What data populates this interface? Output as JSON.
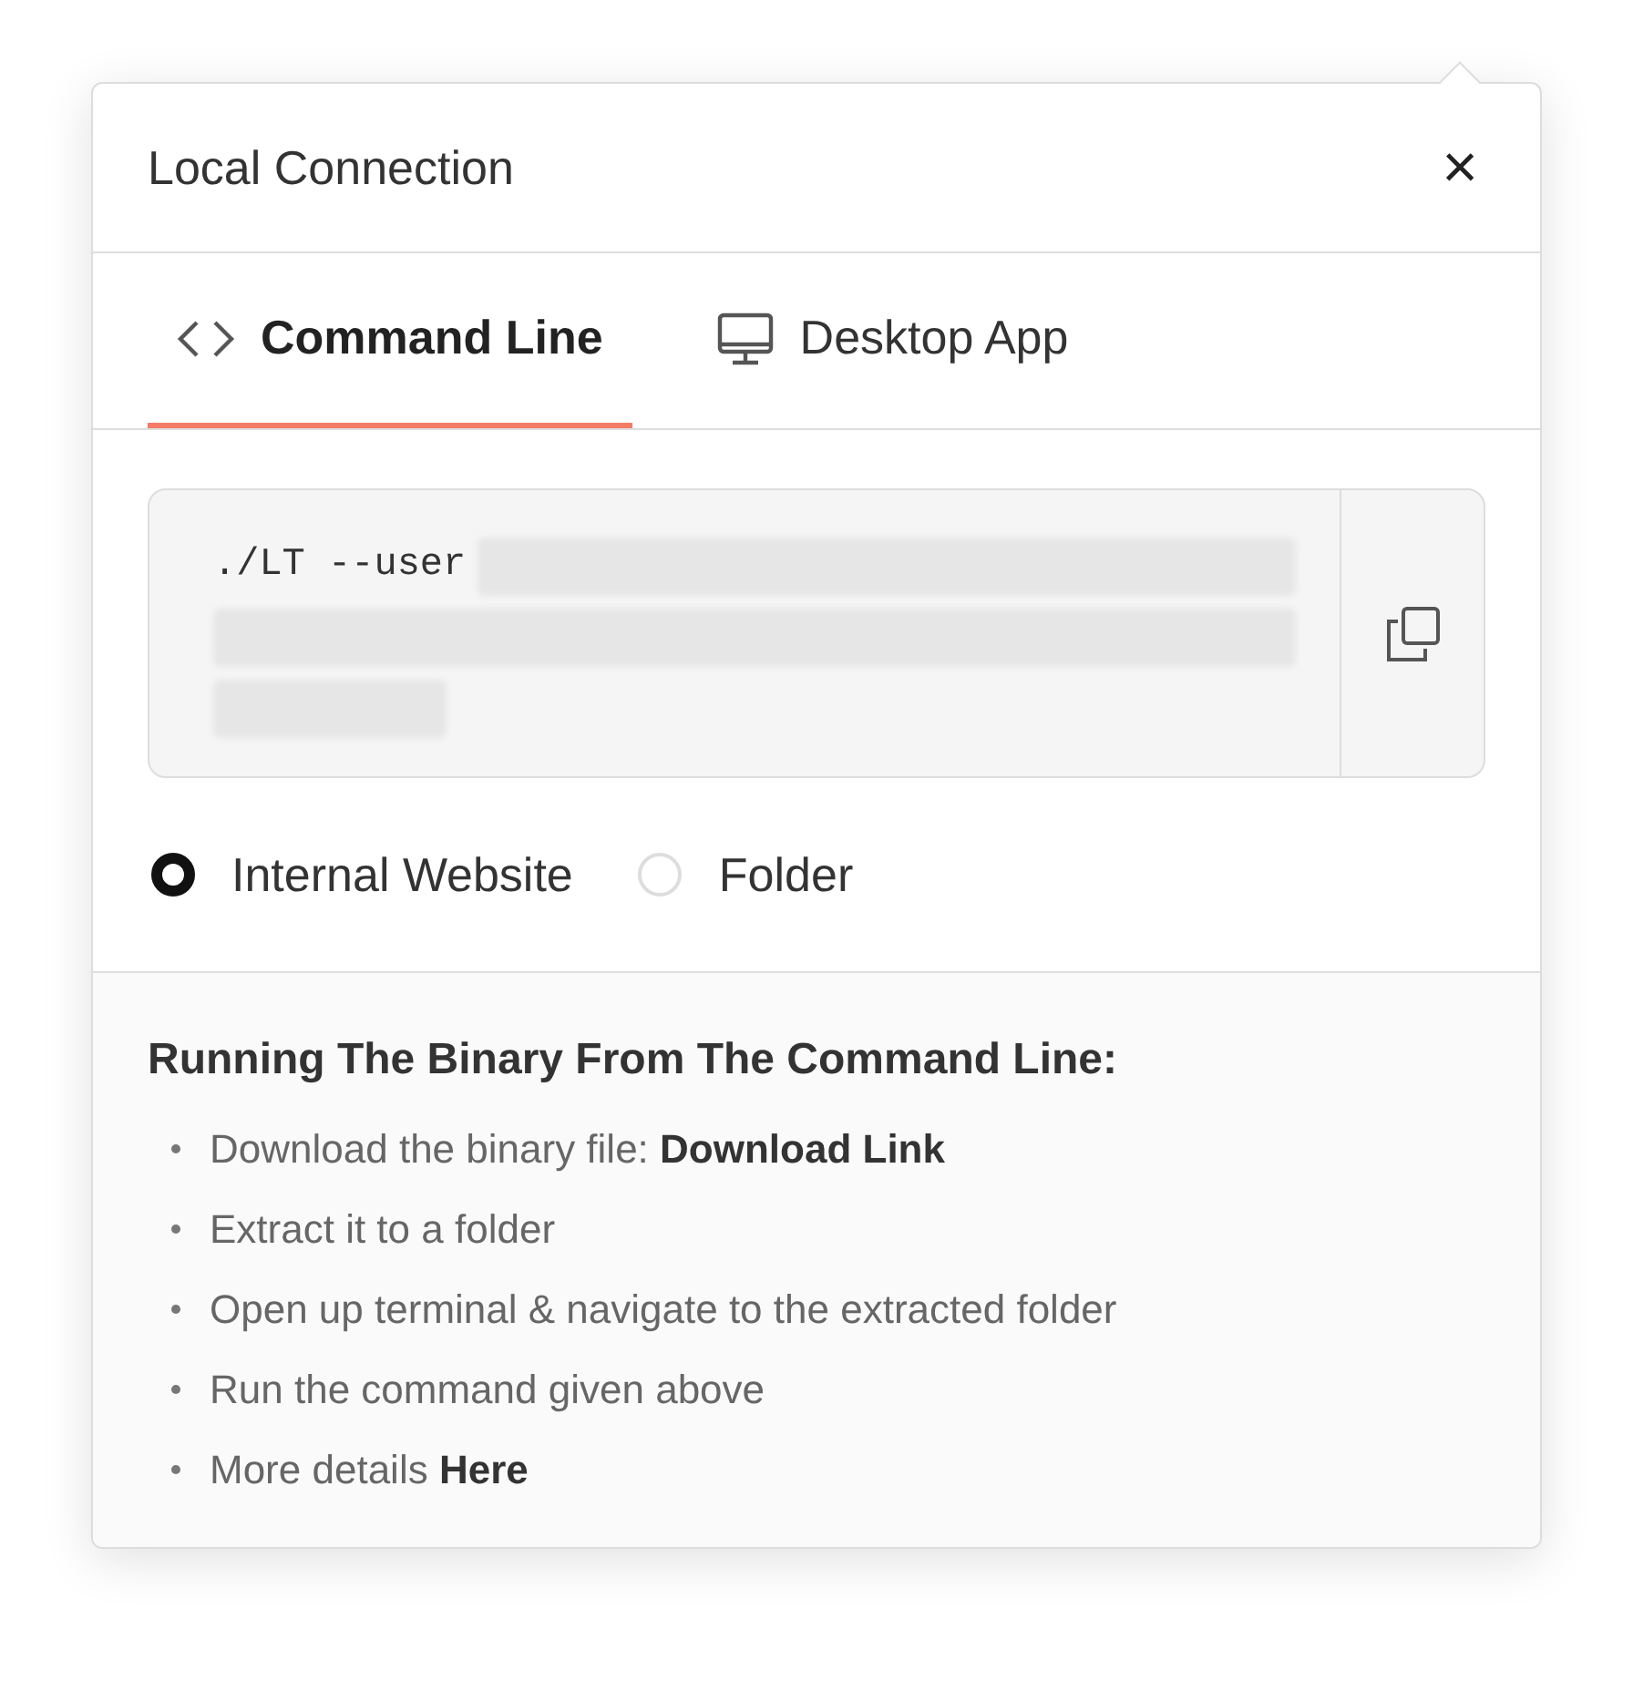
{
  "dialog": {
    "title": "Local Connection",
    "close": "×"
  },
  "tabs": [
    {
      "label": "Command Line",
      "selected": true,
      "kind": "code"
    },
    {
      "label": "Desktop App",
      "selected": false,
      "kind": "desktop"
    }
  ],
  "command": {
    "prefix": "./LT --user"
  },
  "options": [
    {
      "label": "Internal Website",
      "selected": true
    },
    {
      "label": "Folder",
      "selected": false
    }
  ],
  "instructions": {
    "heading": "Running The Binary From The Command Line:",
    "steps": [
      {
        "text": "Download the binary file:",
        "link": "Download Link"
      },
      {
        "text": "Extract it to a folder"
      },
      {
        "text": "Open up terminal & navigate to the extracted folder"
      },
      {
        "text": "Run the command given above"
      },
      {
        "text": "More details",
        "link": "Here"
      }
    ]
  }
}
